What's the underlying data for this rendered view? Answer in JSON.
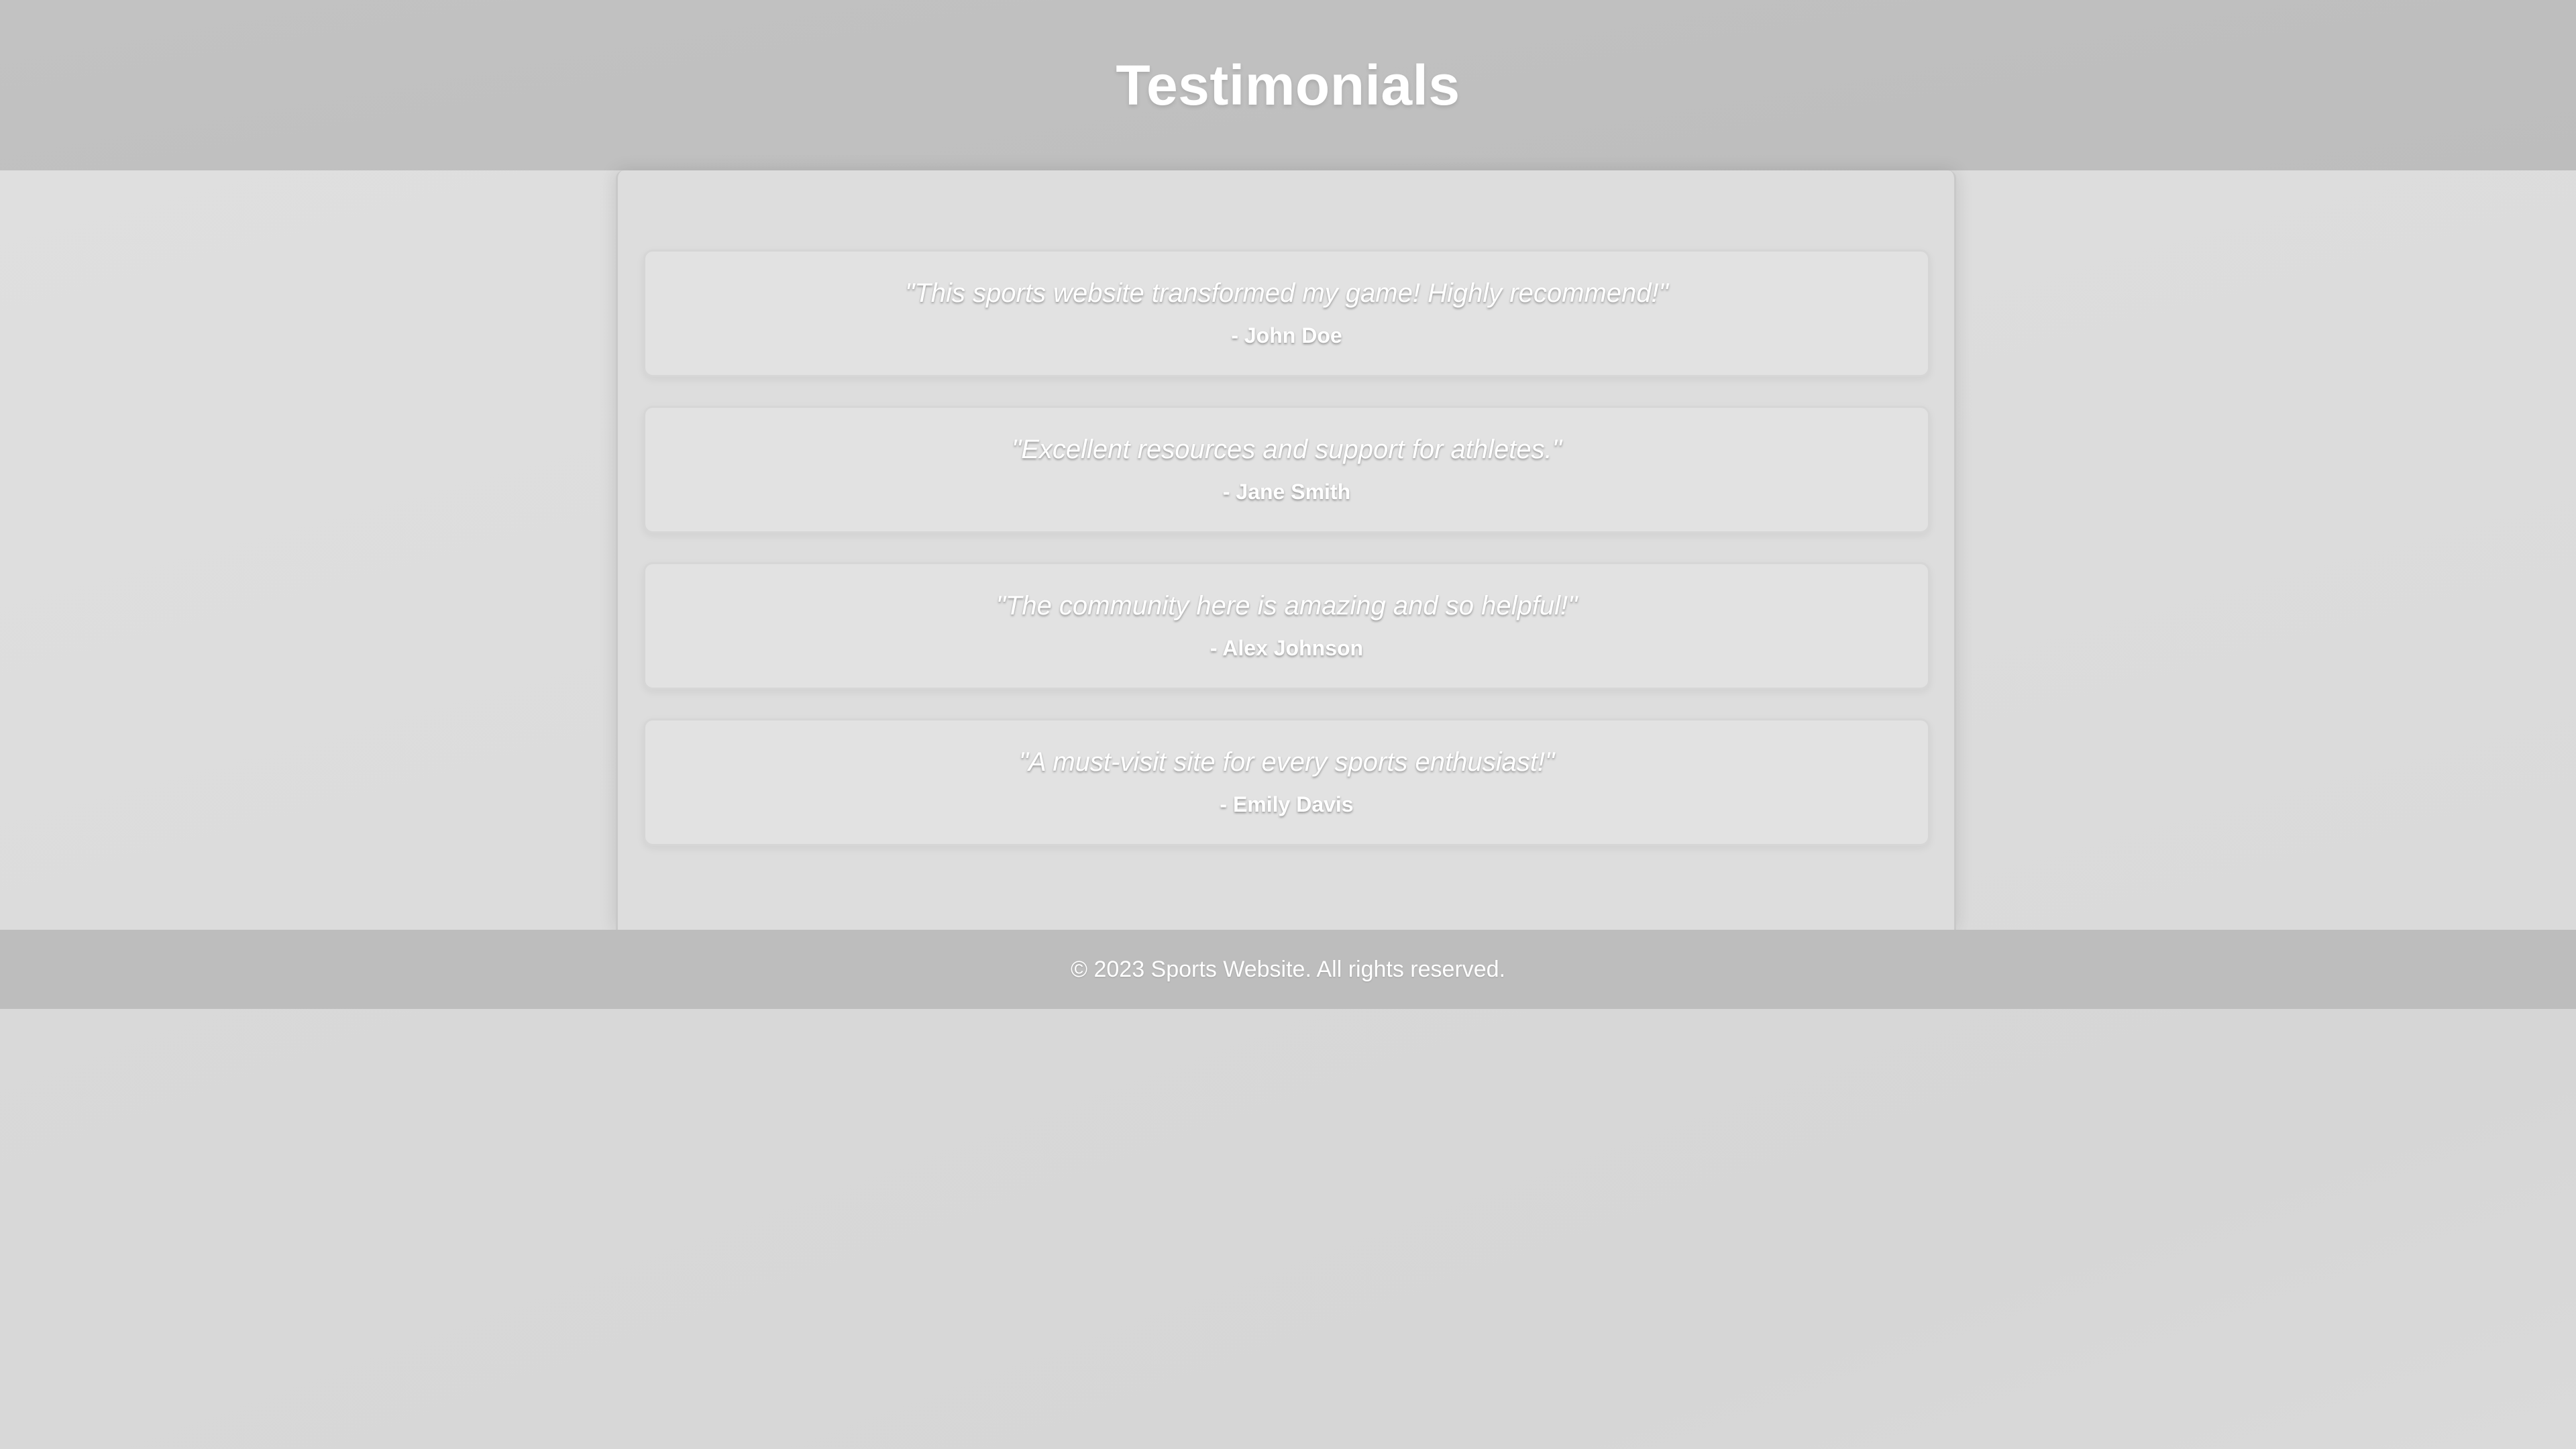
{
  "header": {
    "title": "Testimonials"
  },
  "testimonials": [
    {
      "quote": "\"This sports website transformed my game! Highly recommend!\"",
      "author": "- John Doe"
    },
    {
      "quote": "\"Excellent resources and support for athletes.\"",
      "author": "- Jane Smith"
    },
    {
      "quote": "\"The community here is amazing and so helpful!\"",
      "author": "- Alex Johnson"
    },
    {
      "quote": "\"A must-visit site for every sports enthusiast!\"",
      "author": "- Emily Davis"
    }
  ],
  "footer": {
    "text": "© 2023 Sports Website. All rights reserved."
  },
  "colors": {
    "header_bg": "#bdbdbd",
    "page_bg": "#d9d9d9",
    "card_bg": "#e2e2e2",
    "text": "#ffffff"
  }
}
